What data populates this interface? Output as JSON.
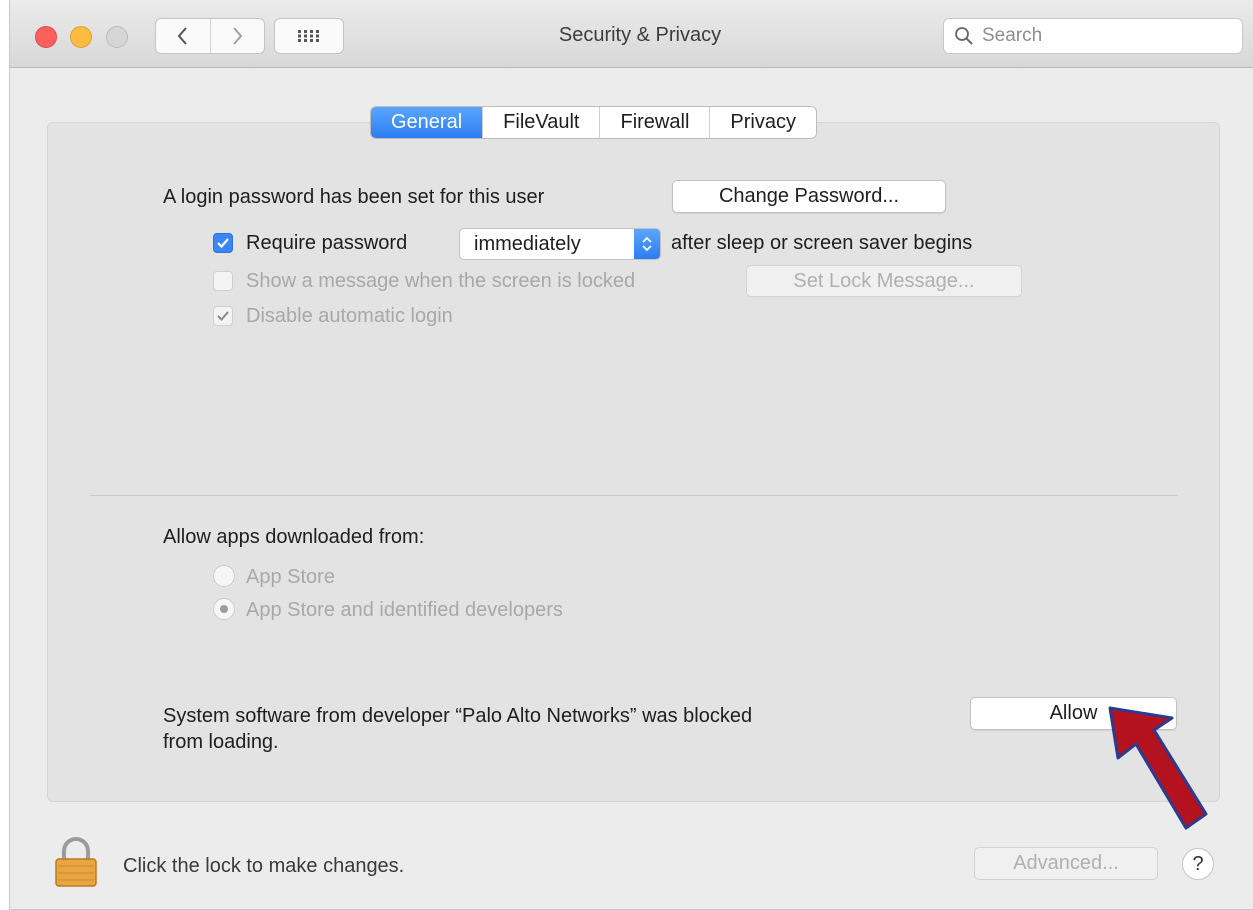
{
  "window": {
    "title": "Security & Privacy"
  },
  "toolbar": {
    "search_placeholder": "Search"
  },
  "tabs": [
    {
      "label": "General",
      "active": true
    },
    {
      "label": "FileVault",
      "active": false
    },
    {
      "label": "Firewall",
      "active": false
    },
    {
      "label": "Privacy",
      "active": false
    }
  ],
  "general": {
    "login_password_text": "A login password has been set for this user",
    "change_password_button": "Change Password...",
    "require_password": {
      "label": "Require password",
      "checked": true,
      "selected_value": "immediately",
      "suffix": "after sleep or screen saver begins"
    },
    "show_message": {
      "label": "Show a message when the screen is locked",
      "checked": false,
      "button": "Set Lock Message..."
    },
    "disable_auto_login": {
      "label": "Disable automatic login",
      "checked": true
    }
  },
  "allow_apps": {
    "heading": "Allow apps downloaded from:",
    "options": [
      {
        "label": "App Store",
        "selected": false
      },
      {
        "label": "App Store and identified developers",
        "selected": true
      }
    ]
  },
  "blocked_notice": {
    "line1": "System software from developer “Palo Alto Networks” was blocked",
    "line2": "from loading.",
    "allow_button": "Allow"
  },
  "footer": {
    "lock_text": "Click the lock to make changes.",
    "advanced_button": "Advanced...",
    "help_label": "?"
  },
  "colors": {
    "accent": "#3a86f6",
    "annotation_arrow": "#b3121e",
    "annotation_outline": "#2b3b8f"
  },
  "icons": {
    "back": "chevron-left-icon",
    "forward": "chevron-right-icon",
    "grid": "grid-icon",
    "search": "magnifying-glass-icon",
    "lock": "padlock-icon",
    "annotation": "red-arrow-icon"
  }
}
